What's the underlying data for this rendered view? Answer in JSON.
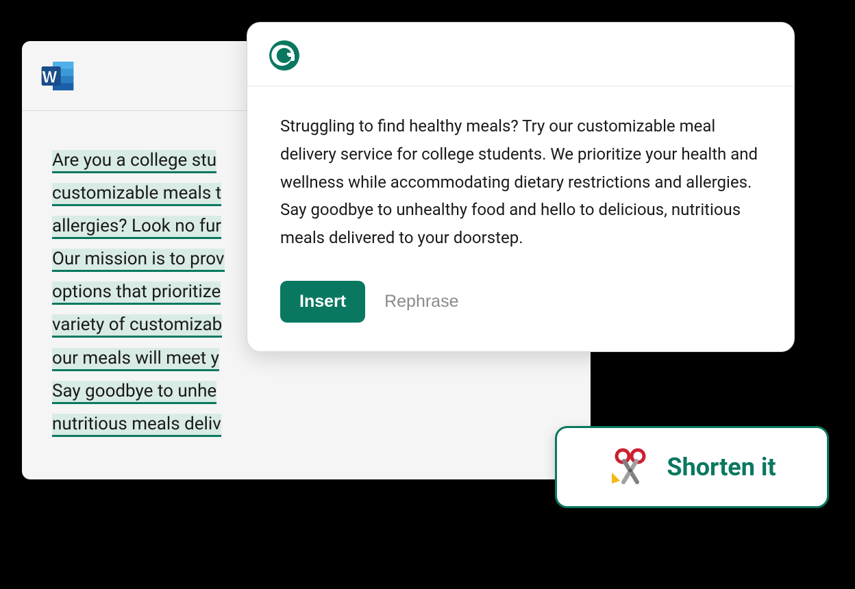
{
  "word_window": {
    "document_lines": [
      "Are you a college stu",
      "customizable meals t",
      "allergies? Look no fur",
      "Our mission is to prov",
      "options that prioritize",
      "variety of customizab",
      "our meals will meet y",
      "Say goodbye to unhe",
      "nutritious meals deliv"
    ]
  },
  "grammarly_popup": {
    "suggestion": "Struggling to find healthy meals? Try our customizable meal delivery service for college students. We prioritize your health and wellness while accommodating dietary restrictions and allergies. Say goodbye to unhealthy food and hello to delicious, nutritious meals delivered to your doorstep.",
    "insert_label": "Insert",
    "rephrase_label": "Rephrase"
  },
  "shorten_badge": {
    "label": "Shorten it"
  },
  "colors": {
    "accent": "#0a7860",
    "highlight_bg": "#d9ebe5"
  }
}
